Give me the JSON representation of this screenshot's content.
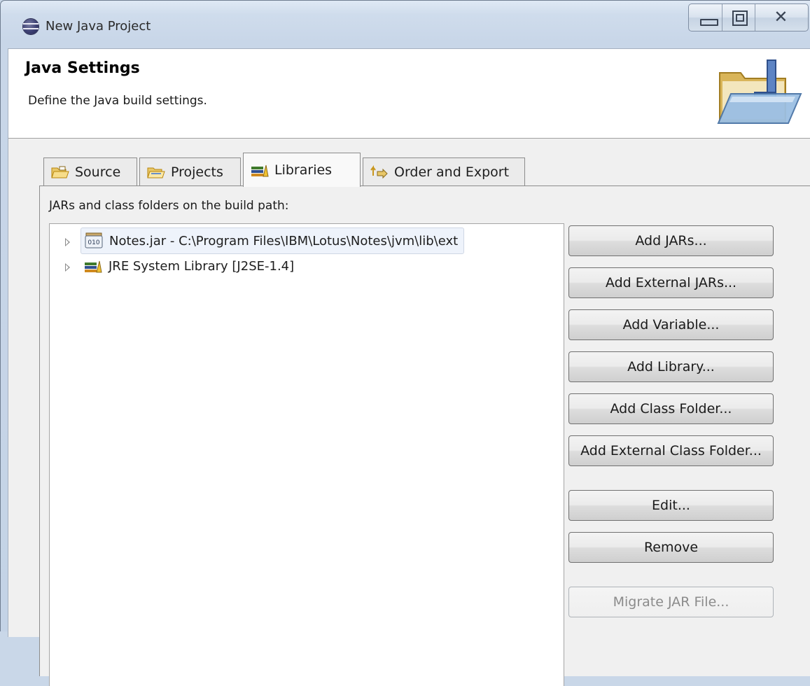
{
  "window": {
    "title": "New Java Project",
    "controls": [
      "minimize",
      "maximize",
      "close"
    ],
    "close_glyph": "✕"
  },
  "header": {
    "title": "Java Settings",
    "description": "Define the Java build settings.",
    "icon": "java-project-folder-icon"
  },
  "tabs": [
    {
      "label": "Source",
      "icon": "source-folder-icon",
      "active": false
    },
    {
      "label": "Projects",
      "icon": "project-folder-icon",
      "active": false
    },
    {
      "label": "Libraries",
      "icon": "libraries-icon",
      "active": true
    },
    {
      "label": "Order and Export",
      "icon": "order-export-icon",
      "active": false
    }
  ],
  "libraries": {
    "label": "JARs and class folders on the build path:",
    "entries": [
      {
        "label": "Notes.jar - C:\\Program Files\\IBM\\Lotus\\Notes\\jvm\\lib\\ext",
        "icon": "jar-icon",
        "selected": true
      },
      {
        "label": "JRE System Library [J2SE-1.4]",
        "icon": "library-icon",
        "selected": false
      }
    ],
    "buttons": [
      {
        "label": "Add JARs...",
        "enabled": true
      },
      {
        "label": "Add External JARs...",
        "enabled": true
      },
      {
        "label": "Add Variable...",
        "enabled": true
      },
      {
        "label": "Add Library...",
        "enabled": true
      },
      {
        "label": "Add Class Folder...",
        "enabled": true
      },
      {
        "label": "Add External Class Folder...",
        "enabled": true
      },
      {
        "label": "Edit...",
        "enabled": true
      },
      {
        "label": "Remove",
        "enabled": true
      },
      {
        "label": "Migrate JAR File...",
        "enabled": false
      }
    ]
  }
}
